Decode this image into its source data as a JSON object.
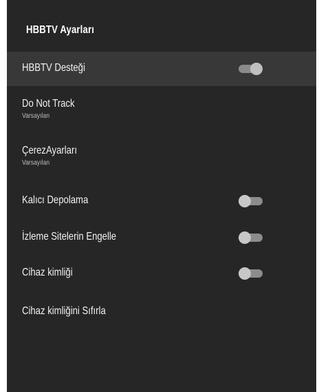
{
  "panel": {
    "title": "HBBTV Ayarları"
  },
  "items": [
    {
      "label": "HBBTV Desteği",
      "sublabel": "",
      "toggle": "on"
    },
    {
      "label": "Do Not Track",
      "sublabel": "Varsayılan",
      "toggle": ""
    },
    {
      "label": "ÇerezAyarları",
      "sublabel": "Varsayılan",
      "toggle": ""
    },
    {
      "label": "Kalıcı Depolama",
      "sublabel": "",
      "toggle": "off"
    },
    {
      "label": "İzleme Sitelerin Engelle",
      "sublabel": "",
      "toggle": "off"
    },
    {
      "label": "Cihaz kimliği",
      "sublabel": "",
      "toggle": "off"
    },
    {
      "label": "Cihaz kimliğini Sıfırla",
      "sublabel": "",
      "toggle": ""
    }
  ],
  "colors": {
    "panel_background": "#262626",
    "selected_row": "#383838",
    "text": "#f2f2f2",
    "subtext": "#bdbdbd"
  }
}
